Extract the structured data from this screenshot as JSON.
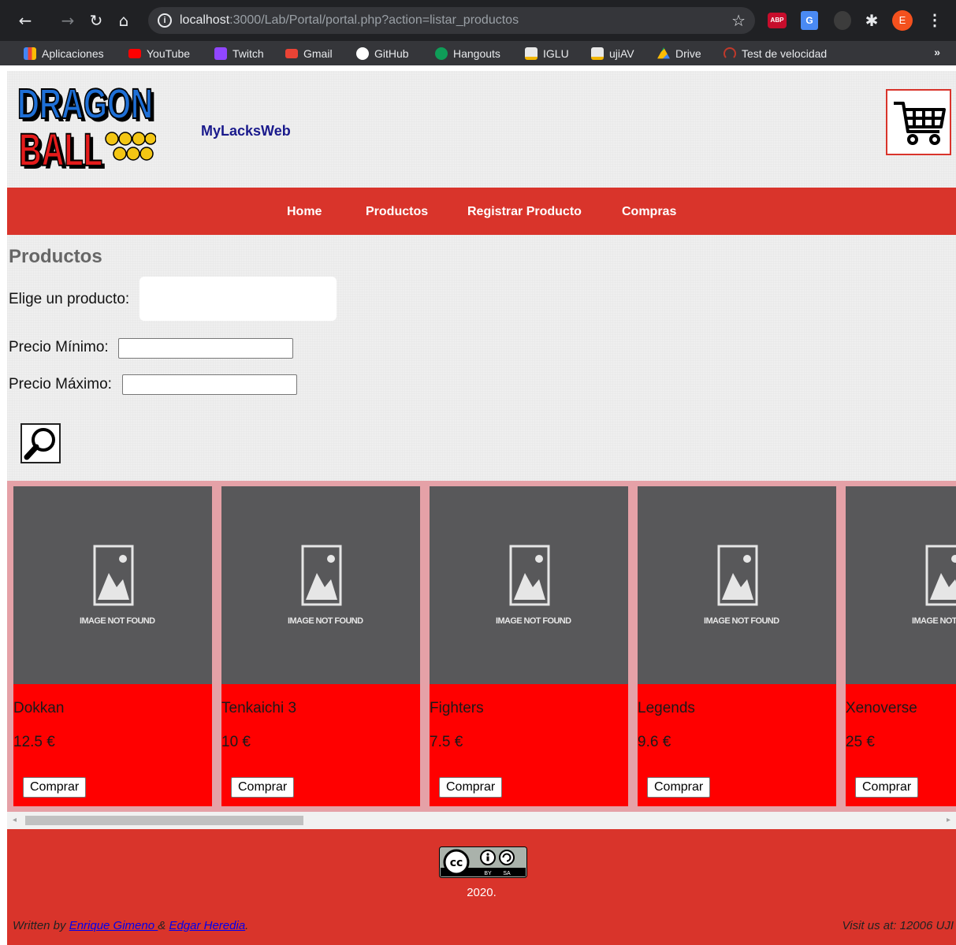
{
  "browser": {
    "url_host": "localhost",
    "url_rest": ":3000/Lab/Portal/portal.php?action=listar_productos",
    "avatar_letter": "E",
    "abp_label": "ABP",
    "bookmarks": [
      "Aplicaciones",
      "YouTube",
      "Twitch",
      "Gmail",
      "GitHub",
      "Hangouts",
      "IGLU",
      "ujiAV",
      "Drive",
      "Test de velocidad"
    ],
    "more": "»"
  },
  "header": {
    "site_name": "MyLacksWeb"
  },
  "nav": {
    "items": [
      "Home",
      "Productos",
      "Registrar Producto",
      "Compras"
    ]
  },
  "search": {
    "title": "Productos",
    "product_label": "Elige un producto:",
    "min_label": "Precio Mínimo:",
    "max_label": "Precio Máximo:",
    "min_value": "",
    "max_value": ""
  },
  "products": [
    {
      "name": "Dokkan",
      "price": "12.5 €",
      "button": "Comprar",
      "image_text": "IMAGE NOT FOUND"
    },
    {
      "name": "Tenkaichi 3",
      "price": "10 €",
      "button": "Comprar",
      "image_text": "IMAGE NOT FOUND"
    },
    {
      "name": "Fighters",
      "price": "7.5 €",
      "button": "Comprar",
      "image_text": "IMAGE NOT FOUND"
    },
    {
      "name": "Legends",
      "price": "9.6 €",
      "button": "Comprar",
      "image_text": "IMAGE NOT FOUND"
    },
    {
      "name": "Xenoverse",
      "price": "25 €",
      "button": "Comprar",
      "image_text": "IMAGE NOT FOUND"
    }
  ],
  "footer": {
    "year": "2020.",
    "written_by": "Written by ",
    "author1": "Enrique Gimeno ",
    "amp": "& ",
    "author2": "Edgar Heredia",
    "period": ".",
    "visit": "Visit us at: 12006 UJI",
    "cc_by": "BY",
    "cc_sa": "SA"
  },
  "colors": {
    "navbar": "#d9342b",
    "card_body": "#ff0000",
    "card_image": "#58585a",
    "products_bg": "#e5a1a7",
    "site_name": "#1a1a8c"
  }
}
